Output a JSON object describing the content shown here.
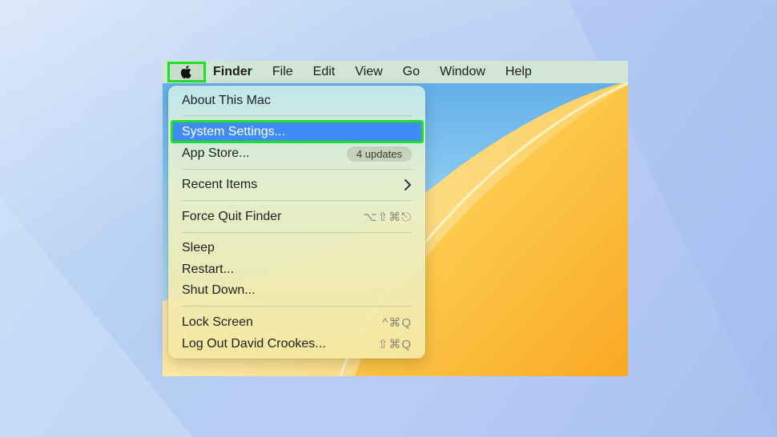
{
  "menubar": {
    "apple_icon": "apple-logo-icon",
    "items": [
      "Finder",
      "File",
      "Edit",
      "View",
      "Go",
      "Window",
      "Help"
    ]
  },
  "apple_menu": {
    "about": "About This Mac",
    "system_settings": "System Settings...",
    "app_store": "App Store...",
    "app_store_badge": "4 updates",
    "recent_items": "Recent Items",
    "force_quit": "Force Quit Finder",
    "force_quit_shortcut": "⌥⇧⌘⎋",
    "sleep": "Sleep",
    "restart": "Restart...",
    "shut_down": "Shut Down...",
    "lock_screen": "Lock Screen",
    "lock_screen_shortcut": "^⌘Q",
    "log_out": "Log Out David Crookes...",
    "log_out_shortcut": "⇧⌘Q"
  },
  "colors": {
    "highlight": "#3f8cf5",
    "callout_outline": "#22e024"
  }
}
